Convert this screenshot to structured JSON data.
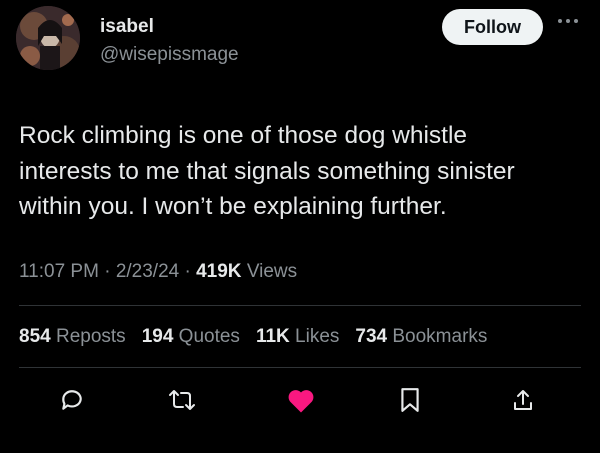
{
  "user": {
    "display_name": "isabel",
    "handle": "@wisepissmage"
  },
  "header": {
    "follow_label": "Follow",
    "more_icon": "more-dots-icon"
  },
  "tweet": {
    "text": "Rock climbing is one of those dog whistle\ninterests to me that signals something sinister\nwithin you. I won’t be explaining further."
  },
  "meta": {
    "time": "11:07 PM",
    "sep1": "·",
    "date": "2/23/24",
    "sep2": "·",
    "views_count": "419K",
    "views_label": "Views"
  },
  "stats": {
    "reposts_count": "854",
    "reposts_label": "Reposts",
    "quotes_count": "194",
    "quotes_label": "Quotes",
    "likes_count": "11K",
    "likes_label": "Likes",
    "bookmarks_count": "734",
    "bookmarks_label": "Bookmarks"
  },
  "actions": {
    "reply_icon": "reply-icon",
    "repost_icon": "repost-icon",
    "like_icon": "like-heart-icon",
    "bookmark_icon": "bookmark-icon",
    "share_icon": "share-icon",
    "like_color": "#f91880"
  },
  "colors": {
    "background": "#000000",
    "text_primary": "#e7e9ea",
    "text_secondary": "#8b9196",
    "divider": "#2f3336",
    "follow_bg": "#eff3f4"
  }
}
